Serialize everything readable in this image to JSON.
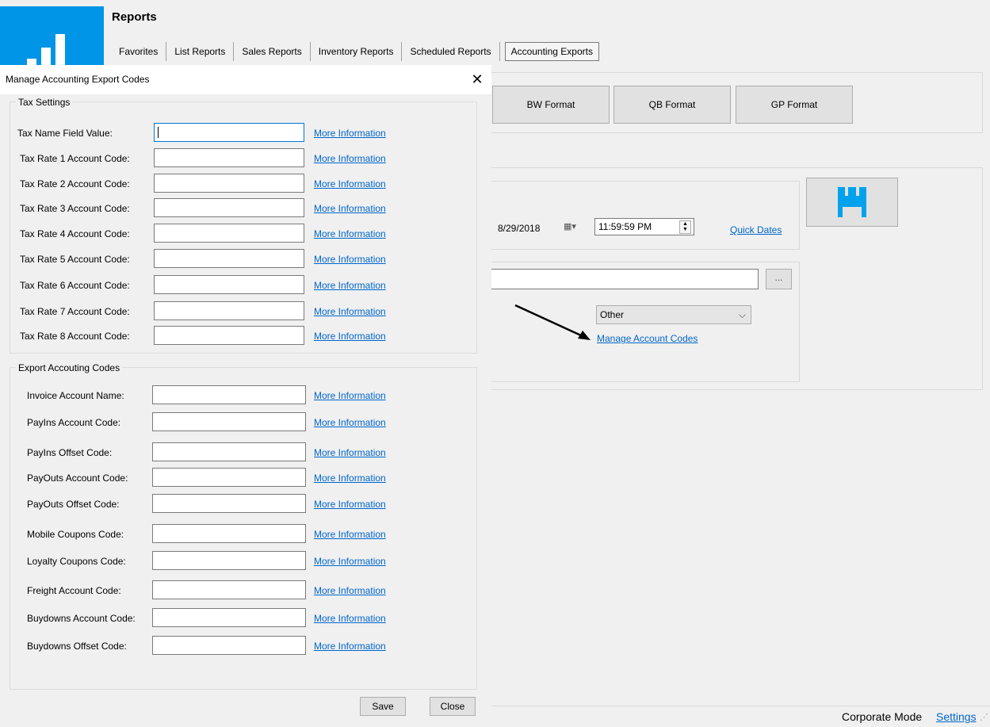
{
  "app": {
    "title": "Reports",
    "tabs": [
      {
        "label": "Favorites"
      },
      {
        "label": "List Reports"
      },
      {
        "label": "Sales Reports"
      },
      {
        "label": "Inventory Reports"
      },
      {
        "label": "Scheduled Reports"
      },
      {
        "label": "Accounting Exports",
        "active": true
      }
    ]
  },
  "formats": {
    "bw": "BW Format",
    "qb": "QB Format",
    "gp": "GP Format"
  },
  "date_range": {
    "end_date": "8/29/2018",
    "end_time": "11:59:59 PM",
    "quick_dates": "Quick Dates"
  },
  "export": {
    "browse_label": "...",
    "type_selected": "Other",
    "manage_link": "Manage Account Codes"
  },
  "dialog": {
    "title": "Manage Accounting Export Codes",
    "tax_group": "Tax Settings",
    "tax_rows": [
      {
        "label": "Tax Name Field Value:",
        "link": "More Information"
      },
      {
        "label": "Tax Rate 1 Account Code:",
        "link": "More Information"
      },
      {
        "label": "Tax Rate 2 Account Code:",
        "link": "More Information"
      },
      {
        "label": "Tax Rate 3 Account Code:",
        "link": "More Information"
      },
      {
        "label": "Tax Rate 4 Account Code:",
        "link": "More Information"
      },
      {
        "label": "Tax Rate 5 Account Code:",
        "link": "More Information"
      },
      {
        "label": "Tax Rate 6 Account Code:",
        "link": "More Information"
      },
      {
        "label": "Tax Rate 7 Account Code:",
        "link": "More Information"
      },
      {
        "label": "Tax Rate 8 Account Code:",
        "link": "More Information"
      }
    ],
    "export_group": "Export Accouting Codes",
    "export_rows": [
      {
        "label": "Invoice Account Name:",
        "link": "More Information"
      },
      {
        "label": "PayIns Account Code:",
        "link": "More Information"
      },
      {
        "label": "PayIns Offset Code:",
        "link": "More Information"
      },
      {
        "label": "PayOuts Account Code:",
        "link": "More Information"
      },
      {
        "label": "PayOuts Offset Code:",
        "link": "More Information"
      },
      {
        "label": "Mobile Coupons Code:",
        "link": "More Information"
      },
      {
        "label": "Loyalty Coupons Code:",
        "link": "More Information"
      },
      {
        "label": "Freight Account Code:",
        "link": "More Information"
      },
      {
        "label": "Buydowns Account Code:",
        "link": "More Information"
      },
      {
        "label": "Buydowns Offset Code:",
        "link": "More Information"
      }
    ],
    "save_label": "Save",
    "close_label": "Close"
  },
  "status": {
    "mode": "Corporate Mode",
    "settings_link": "Settings"
  },
  "colors": {
    "brand": "#0095e6",
    "link": "#0066cc"
  }
}
